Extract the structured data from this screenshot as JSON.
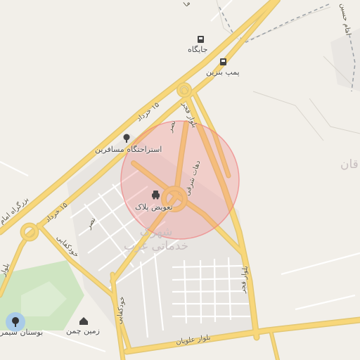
{
  "pois": {
    "jaygah": "جایگاه",
    "pomp_benzin": "پمپ بنزین",
    "esterahatgah": "استراحتگاه مسافرین",
    "taviz_pelak": "تعویض پلاک",
    "bustan": "بوستان سیمر",
    "zamin_chaman": "زمین چمن"
  },
  "roads": {
    "khordad_15_top": "۱۵ خرداد",
    "khordad_15_left": "۱۵ خرداد",
    "bolvar_fajr_top": "بلوار فجر",
    "bolvar_fajr_bottom": "بلوار فجر",
    "nasr_top": "نصر",
    "nasr_bottom": "نصر",
    "dehat_sharghi": "دهات شرقی",
    "khodkafayi_top": "خودکفایی",
    "khodkafayi_bottom": "خودکفایی",
    "bolvar_alavian": "بلوار علویان",
    "bozorgrah_imam": "بزرگراه امام",
    "bolvar_left": "بلوار",
    "imam_hossein": "امام حسین",
    "ma_top": "ما"
  },
  "districts": {
    "shahrak_line1": "شهرک",
    "shahrak_line2": "خدماتی غرب",
    "right_partial": "قان"
  },
  "highlight": {
    "color": "#f08080"
  }
}
